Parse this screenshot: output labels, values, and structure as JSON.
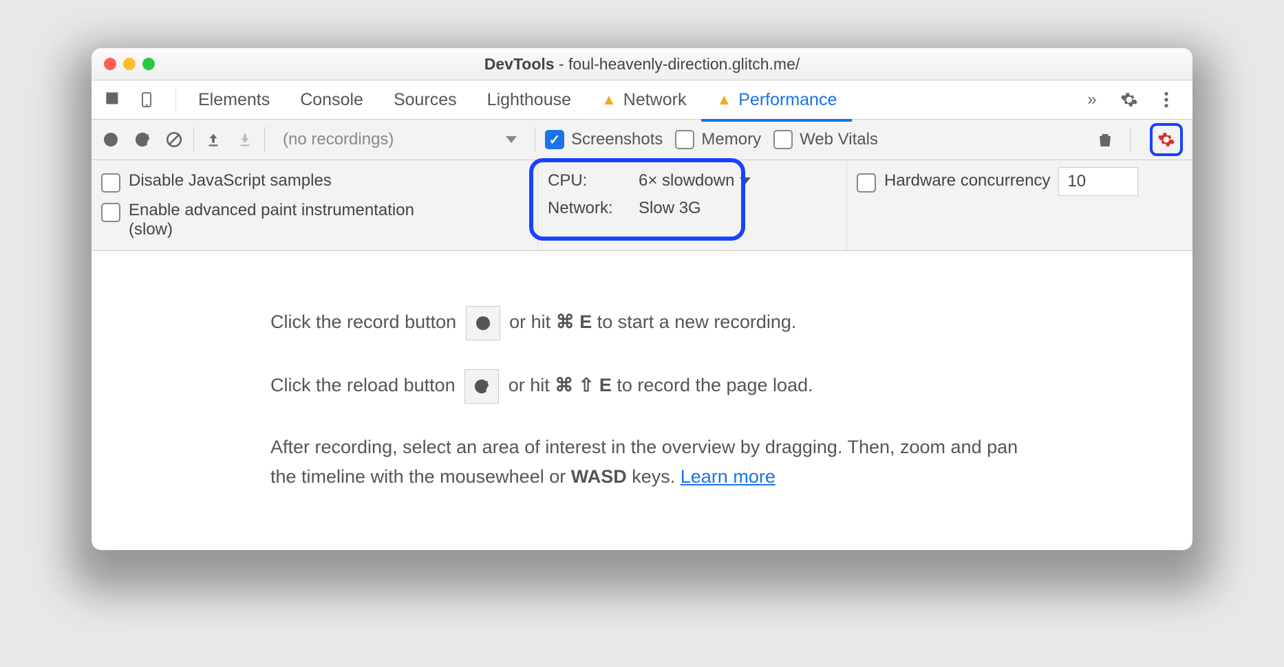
{
  "window": {
    "title_prefix": "DevTools",
    "title_url": "foul-heavenly-direction.glitch.me/"
  },
  "tabs": [
    "Elements",
    "Console",
    "Sources",
    "Lighthouse",
    "Network",
    "Performance"
  ],
  "tabs_warning_indexes": [
    4,
    5
  ],
  "tabs_selected": 5,
  "toolbar": {
    "no_recordings": "(no recordings)",
    "screenshots": "Screenshots",
    "memory": "Memory",
    "webvitals": "Web Vitals"
  },
  "capture": {
    "disable_js": "Disable JavaScript samples",
    "paint_instr": "Enable advanced paint instrumentation (slow)",
    "cpu_label": "CPU:",
    "cpu_value": "6× slowdown",
    "net_label": "Network:",
    "net_value": "Slow 3G",
    "hw_label": "Hardware concurrency",
    "hw_value": "10"
  },
  "body": {
    "line1a": "Click the record button ",
    "line1b": " or hit ",
    "cmd": "⌘",
    "shift": "⇧",
    "E": "E",
    "line1c": " to start a new recording.",
    "line2a": "Click the reload button ",
    "line2b": " or hit ",
    "line2c": " to record the page load.",
    "line3a": "After recording, select an area of interest in the overview by dragging. Then, zoom and pan the timeline with the mousewheel or ",
    "wasd": "WASD",
    "line3b": " keys. ",
    "learn": "Learn more"
  }
}
